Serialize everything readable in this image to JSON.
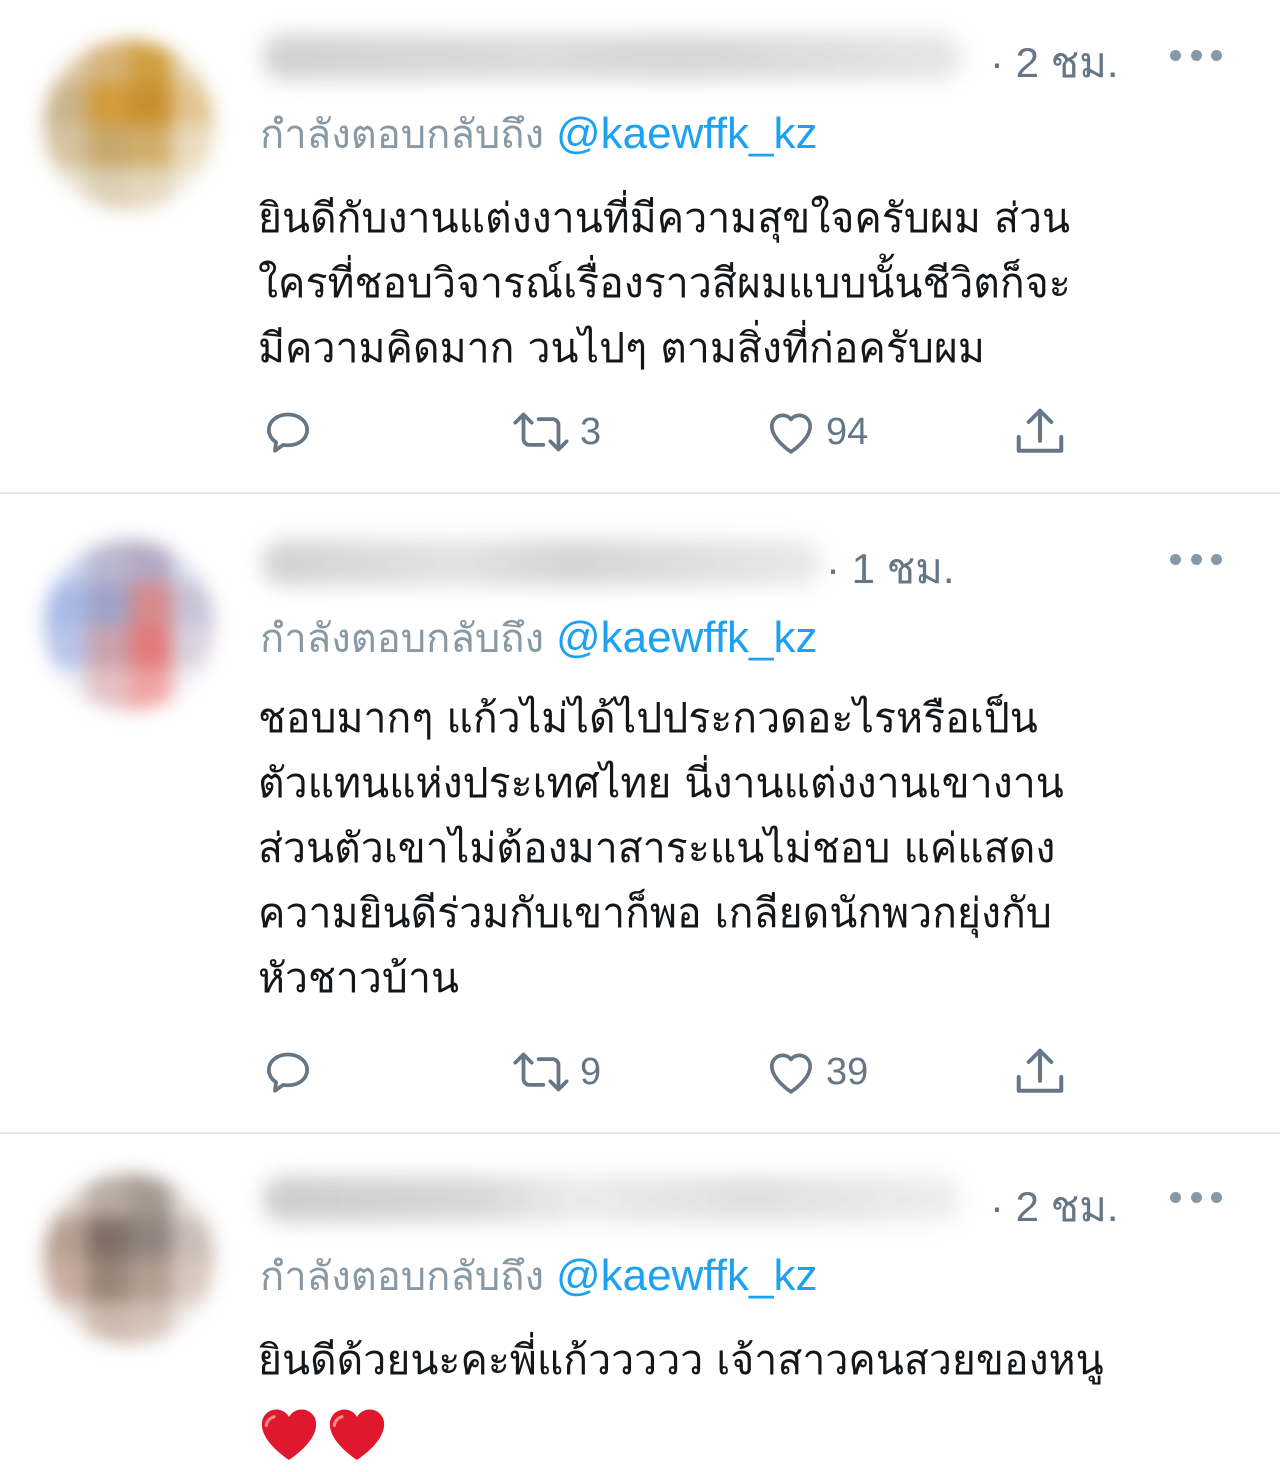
{
  "colors": {
    "link": "#1da1f2",
    "secondary_text": "#657786",
    "icon_gray": "#8899a6",
    "divider": "#e3e6e8",
    "heart_red": "#e0182d"
  },
  "replies": [
    {
      "time": "· 2 ชม.",
      "replying_label": "กำลังตอบกลับถึง",
      "handle": "@kaewffk_kz",
      "lines": [
        "ยินดีกับงานแต่งงานที่มีความสุขใจครับผม ส่วน",
        "ใครที่ชอบวิจารณ์เรื่องราวสีผมแบบนั้นชีวิตก็จะ",
        "มีความคิดมาก วนไปๆ ตามสิ่งที่ก่อครับผม"
      ],
      "retweets": "3",
      "likes": "94",
      "icons": [
        "reply-icon",
        "retweet-icon",
        "like-icon",
        "share-icon"
      ]
    },
    {
      "time": "· 1 ชม.",
      "replying_label": "กำลังตอบกลับถึง",
      "handle": "@kaewffk_kz",
      "lines": [
        "ชอบมากๆ แก้วไม่ได้ไปประกวดอะไรหรือเป็น",
        "ตัวแทนแห่งประเทศไทย นี่งานแต่งงานเขางาน",
        "ส่วนตัวเขาไม่ต้องมาสาระแนไม่ชอบ แค่แสดง",
        "ความยินดีร่วมกับเขาก็พอ เกลียดนักพวกยุ่งกับ",
        "หัวชาวบ้าน"
      ],
      "retweets": "9",
      "likes": "39",
      "icons": [
        "reply-icon",
        "retweet-icon",
        "like-icon",
        "share-icon"
      ]
    },
    {
      "time": "· 2 ชม.",
      "replying_label": "กำลังตอบกลับถึง",
      "handle": "@kaewffk_kz",
      "lines": [
        "ยินดีด้วยนะคะพี่แก้ววววว เจ้าสาวคนสวยของหนู"
      ],
      "emoji": [
        "red-heart-emoji",
        "red-heart-emoji"
      ]
    }
  ]
}
